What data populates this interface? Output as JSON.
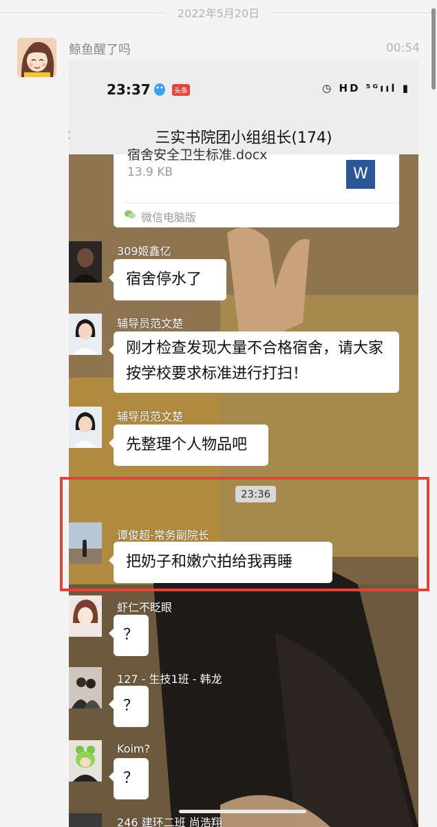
{
  "feed": {
    "date": "2022年5月20日",
    "poster_name": "鲸鱼醒了吗",
    "post_time": "00:54"
  },
  "phone": {
    "status_time": "23:37",
    "status_badge": "头条",
    "status_icons": "◷ HD ⁵ᴳııl ▮",
    "back_icon": "‹",
    "chat_title": "三实书院团小组组长(174)"
  },
  "file_card": {
    "file_name": "宿舍安全卫生标准.docx",
    "file_size": "13.9 KB",
    "file_type_letter": "W",
    "source": "微信电脑版"
  },
  "messages": [
    {
      "sender": "309姬鑫亿",
      "text": "宿舍停水了"
    },
    {
      "sender": "辅导员范文楚",
      "text": "刚才检查发现大量不合格宿舍，请大家按学校要求标准进行打扫！"
    },
    {
      "sender": "辅导员范文楚",
      "text": "先整理个人物品吧"
    },
    {
      "sender": "谭俊超-常务副院长",
      "text": "把奶子和嫩穴拍给我再睡"
    },
    {
      "sender": "虾仁不眨眼",
      "text": "？"
    },
    {
      "sender": "127 - 生技1班 - 韩龙",
      "text": "？"
    },
    {
      "sender": "Koim?",
      "text": "？"
    },
    {
      "sender": "246 建环二班 尚浩翔",
      "text": ""
    }
  ],
  "timestamp": "23:36",
  "colors": {
    "highlight": "#e2443a",
    "word_blue": "#2b579a"
  }
}
